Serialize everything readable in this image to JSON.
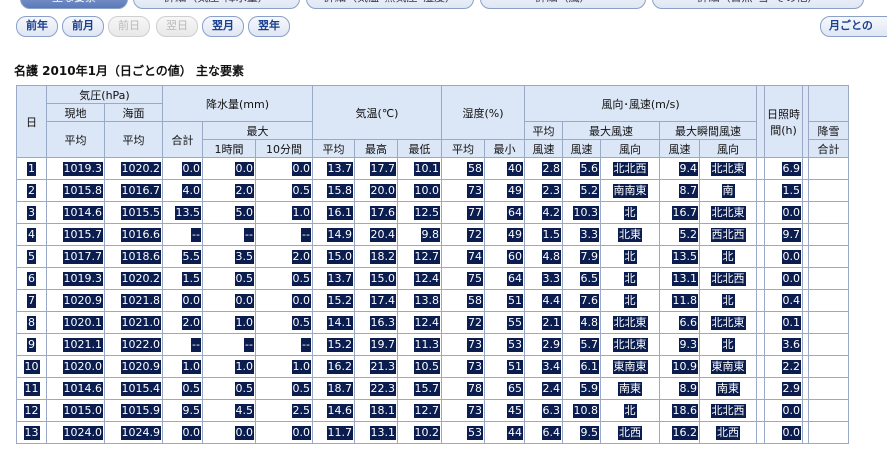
{
  "tabs": [
    {
      "label": "主な要素",
      "active": true
    },
    {
      "label": "詳細（気圧･降水量）",
      "active": false
    },
    {
      "label": "詳細（気温･蒸気圧･湿度）",
      "active": false
    },
    {
      "label": "詳細（風）",
      "active": false
    },
    {
      "label": "詳細（日照･雪･その他）",
      "active": false
    }
  ],
  "nav": {
    "prev_year": "前年",
    "prev_month": "前月",
    "prev_day": "前日",
    "next_day": "翌日",
    "next_month": "翌月",
    "next_year": "翌年",
    "by_month": "月ごとの"
  },
  "page_title": "名護  2010年1月（日ごとの値） 主な要素",
  "table": {
    "h_day": "日",
    "h_pressure": "気圧(hPa)",
    "h_pressure_station": "現地",
    "h_pressure_sea": "海面",
    "h_avg": "平均",
    "h_precip": "降水量(mm)",
    "h_total": "合計",
    "h_max": "最大",
    "h_1h": "1時間",
    "h_10m": "10分間",
    "h_temp": "気温(℃)",
    "h_high": "最高",
    "h_low": "最低",
    "h_humidity": "湿度(%)",
    "h_min": "最小",
    "h_wind": "風向･風速(m/s)",
    "h_avg_wind": "平均",
    "h_wind_speed": "風速",
    "h_max_wind": "最大風速",
    "h_max_gust": "最大瞬間風速",
    "h_wind_dir": "風向",
    "h_sunshine": "日照時間(h)",
    "h_snow": "降雪",
    "rows": [
      {
        "day": "1",
        "p_st": "1019.3",
        "p_sea": "1020.2",
        "pr_total": "0.0",
        "pr_1h": "0.0",
        "pr_10m": "0.0",
        "t_avg": "13.7",
        "t_high": "17.7",
        "t_low": "10.1",
        "h_avg": "58",
        "h_min": "40",
        "w_avg": "2.8",
        "w_max": "5.6",
        "w_max_dir": "北北西",
        "w_gust": "9.4",
        "w_gust_dir": "北北東",
        "sun": "6.9"
      },
      {
        "day": "2",
        "p_st": "1015.8",
        "p_sea": "1016.7",
        "pr_total": "4.0",
        "pr_1h": "2.0",
        "pr_10m": "0.5",
        "t_avg": "15.8",
        "t_high": "20.0",
        "t_low": "10.0",
        "h_avg": "73",
        "h_min": "49",
        "w_avg": "2.3",
        "w_max": "5.2",
        "w_max_dir": "南南東",
        "w_gust": "8.7",
        "w_gust_dir": "南",
        "sun": "1.5"
      },
      {
        "day": "3",
        "p_st": "1014.6",
        "p_sea": "1015.5",
        "pr_total": "13.5",
        "pr_1h": "5.0",
        "pr_10m": "1.0",
        "t_avg": "16.1",
        "t_high": "17.6",
        "t_low": "12.5",
        "h_avg": "77",
        "h_min": "64",
        "w_avg": "4.2",
        "w_max": "10.3",
        "w_max_dir": "北",
        "w_gust": "16.7",
        "w_gust_dir": "北北東",
        "sun": "0.0"
      },
      {
        "day": "4",
        "p_st": "1015.7",
        "p_sea": "1016.6",
        "pr_total": "--",
        "pr_1h": "--",
        "pr_10m": "--",
        "t_avg": "14.9",
        "t_high": "20.4",
        "t_low": "9.8",
        "h_avg": "72",
        "h_min": "49",
        "w_avg": "1.5",
        "w_max": "3.3",
        "w_max_dir": "北東",
        "w_gust": "5.2",
        "w_gust_dir": "西北西",
        "sun": "9.7"
      },
      {
        "day": "5",
        "p_st": "1017.7",
        "p_sea": "1018.6",
        "pr_total": "5.5",
        "pr_1h": "3.5",
        "pr_10m": "2.0",
        "t_avg": "15.0",
        "t_high": "18.2",
        "t_low": "12.7",
        "h_avg": "74",
        "h_min": "60",
        "w_avg": "4.8",
        "w_max": "7.9",
        "w_max_dir": "北",
        "w_gust": "13.5",
        "w_gust_dir": "北",
        "sun": "0.0"
      },
      {
        "day": "6",
        "p_st": "1019.3",
        "p_sea": "1020.2",
        "pr_total": "1.5",
        "pr_1h": "0.5",
        "pr_10m": "0.5",
        "t_avg": "13.7",
        "t_high": "15.0",
        "t_low": "12.4",
        "h_avg": "75",
        "h_min": "64",
        "w_avg": "3.3",
        "w_max": "6.5",
        "w_max_dir": "北",
        "w_gust": "13.1",
        "w_gust_dir": "北北西",
        "sun": "0.0"
      },
      {
        "day": "7",
        "p_st": "1020.9",
        "p_sea": "1021.8",
        "pr_total": "0.0",
        "pr_1h": "0.0",
        "pr_10m": "0.0",
        "t_avg": "15.2",
        "t_high": "17.4",
        "t_low": "13.8",
        "h_avg": "58",
        "h_min": "51",
        "w_avg": "4.4",
        "w_max": "7.6",
        "w_max_dir": "北",
        "w_gust": "11.8",
        "w_gust_dir": "北",
        "sun": "0.4"
      },
      {
        "day": "8",
        "p_st": "1020.1",
        "p_sea": "1021.0",
        "pr_total": "2.0",
        "pr_1h": "1.0",
        "pr_10m": "0.5",
        "t_avg": "14.1",
        "t_high": "16.3",
        "t_low": "12.4",
        "h_avg": "72",
        "h_min": "55",
        "w_avg": "2.1",
        "w_max": "4.8",
        "w_max_dir": "北北東",
        "w_gust": "6.6",
        "w_gust_dir": "北北東",
        "sun": "0.1"
      },
      {
        "day": "9",
        "p_st": "1021.1",
        "p_sea": "1022.0",
        "pr_total": "--",
        "pr_1h": "--",
        "pr_10m": "--",
        "t_avg": "15.2",
        "t_high": "19.7",
        "t_low": "11.3",
        "h_avg": "73",
        "h_min": "53",
        "w_avg": "2.9",
        "w_max": "5.7",
        "w_max_dir": "北北東",
        "w_gust": "9.3",
        "w_gust_dir": "北",
        "sun": "3.6"
      },
      {
        "day": "10",
        "p_st": "1020.0",
        "p_sea": "1020.9",
        "pr_total": "1.0",
        "pr_1h": "1.0",
        "pr_10m": "1.0",
        "t_avg": "16.2",
        "t_high": "21.3",
        "t_low": "10.5",
        "h_avg": "73",
        "h_min": "51",
        "w_avg": "3.4",
        "w_max": "6.1",
        "w_max_dir": "東南東",
        "w_gust": "10.9",
        "w_gust_dir": "東南東",
        "sun": "2.2"
      },
      {
        "day": "11",
        "p_st": "1014.6",
        "p_sea": "1015.4",
        "pr_total": "0.5",
        "pr_1h": "0.5",
        "pr_10m": "0.5",
        "t_avg": "18.7",
        "t_high": "22.3",
        "t_low": "15.7",
        "h_avg": "78",
        "h_min": "65",
        "w_avg": "2.4",
        "w_max": "5.9",
        "w_max_dir": "南東",
        "w_gust": "8.9",
        "w_gust_dir": "南東",
        "sun": "2.9"
      },
      {
        "day": "12",
        "p_st": "1015.0",
        "p_sea": "1015.9",
        "pr_total": "9.5",
        "pr_1h": "4.5",
        "pr_10m": "2.5",
        "t_avg": "14.6",
        "t_high": "18.1",
        "t_low": "12.7",
        "h_avg": "73",
        "h_min": "45",
        "w_avg": "6.3",
        "w_max": "10.8",
        "w_max_dir": "北",
        "w_gust": "18.6",
        "w_gust_dir": "北北西",
        "sun": "0.0"
      },
      {
        "day": "13",
        "p_st": "1024.0",
        "p_sea": "1024.9",
        "pr_total": "0.0",
        "pr_1h": "0.0",
        "pr_10m": "0.0",
        "t_avg": "11.7",
        "t_high": "13.1",
        "t_low": "10.2",
        "h_avg": "53",
        "h_min": "44",
        "w_avg": "6.4",
        "w_max": "9.5",
        "w_max_dir": "北西",
        "w_gust": "16.2",
        "w_gust_dir": "北西",
        "sun": "0.0"
      }
    ]
  }
}
